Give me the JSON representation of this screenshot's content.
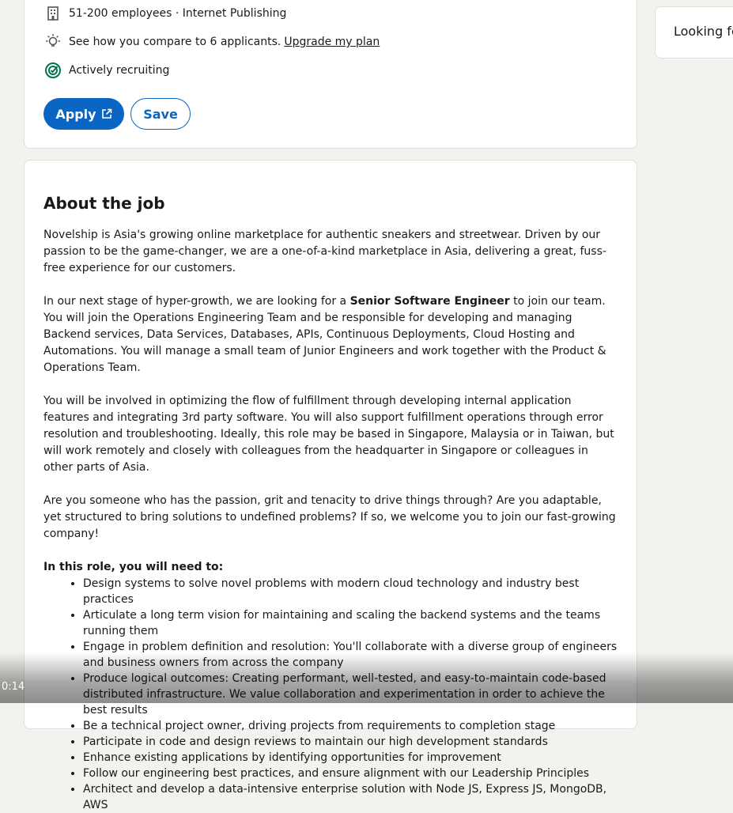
{
  "top_card": {
    "company_size": "51-200 employees · Internet Publishing",
    "compare_text": "See how you compare to 6 applicants.",
    "upgrade_link": "Upgrade my plan",
    "recruiting_text": "Actively recruiting",
    "apply_label": "Apply",
    "save_label": "Save",
    "icons": {
      "company": "building-icon",
      "compare": "lightbulb-icon",
      "recruiting": "target-icon",
      "apply": "external-link-icon"
    }
  },
  "about": {
    "title": "About the job",
    "para1": "Novelship is Asia's growing online marketplace for authentic sneakers and streetwear. Driven by our passion to be the game-changer, we are a one-of-a-kind marketplace in Asia, delivering a great, fuss-free experience for our customers.",
    "para2_before": "In our next stage of hyper-growth, we are looking for a ",
    "para2_bold": "Senior Software Engineer",
    "para2_after": " to join our team. You will join the Operations Engineering Team and be responsible for developing and managing Backend services, Data Services, Databases, APIs, Continuous Deployments, Cloud Hosting and Automations. You will manage a small team of Junior Engineers and work together with the Product & Operations Team.",
    "para3": "You will be involved in optimizing the flow of fulfillment through developing internal application features and integrating 3rd party software. You will also support fulfillment operations through error resolution and troubleshooting. Ideally, this role may be based in Singapore, Malaysia or in Taiwan, but will work remotely and closely with colleagues from the headquarter in Singapore or colleagues in other parts of Asia.",
    "para4": "Are you someone who has the passion, grit and tenacity to drive things through? Are you adaptable, yet structured to bring solutions to undefined problems? If so, we welcome you to join our fast-growing company!",
    "role_heading": "In this role, you will need to:",
    "bullets": [
      "Design systems to solve novel problems with modern cloud technology and industry best practices",
      "Articulate a long term vision for maintaining and scaling the backend systems and the teams running them",
      "Engage in problem definition and resolution: You'll collaborate with a diverse group of engineers and business owners from across the company",
      "Produce logical outcomes: Creating performant, well-tested, and easy-to-maintain code-based distributed infrastructure. We value collaboration and experimentation in order to achieve the best results",
      "Be a technical project owner, driving projects from requirements to completion stage",
      "Participate in code and design reviews to maintain our high development standards",
      "Enhance existing applications by identifying opportunities for improvement",
      "Follow our engineering best practices, and ensure alignment with our Leadership Principles",
      "Architect and develop a data-intensive enterprise solution with Node JS, Express JS, MongoDB, AWS"
    ]
  },
  "side_card": {
    "text": "Looking fo"
  },
  "video": {
    "time": "0:14"
  },
  "colors": {
    "primary": "#0a66c2",
    "recruiting_green": "#01754f",
    "background": "#f4f2ee"
  }
}
